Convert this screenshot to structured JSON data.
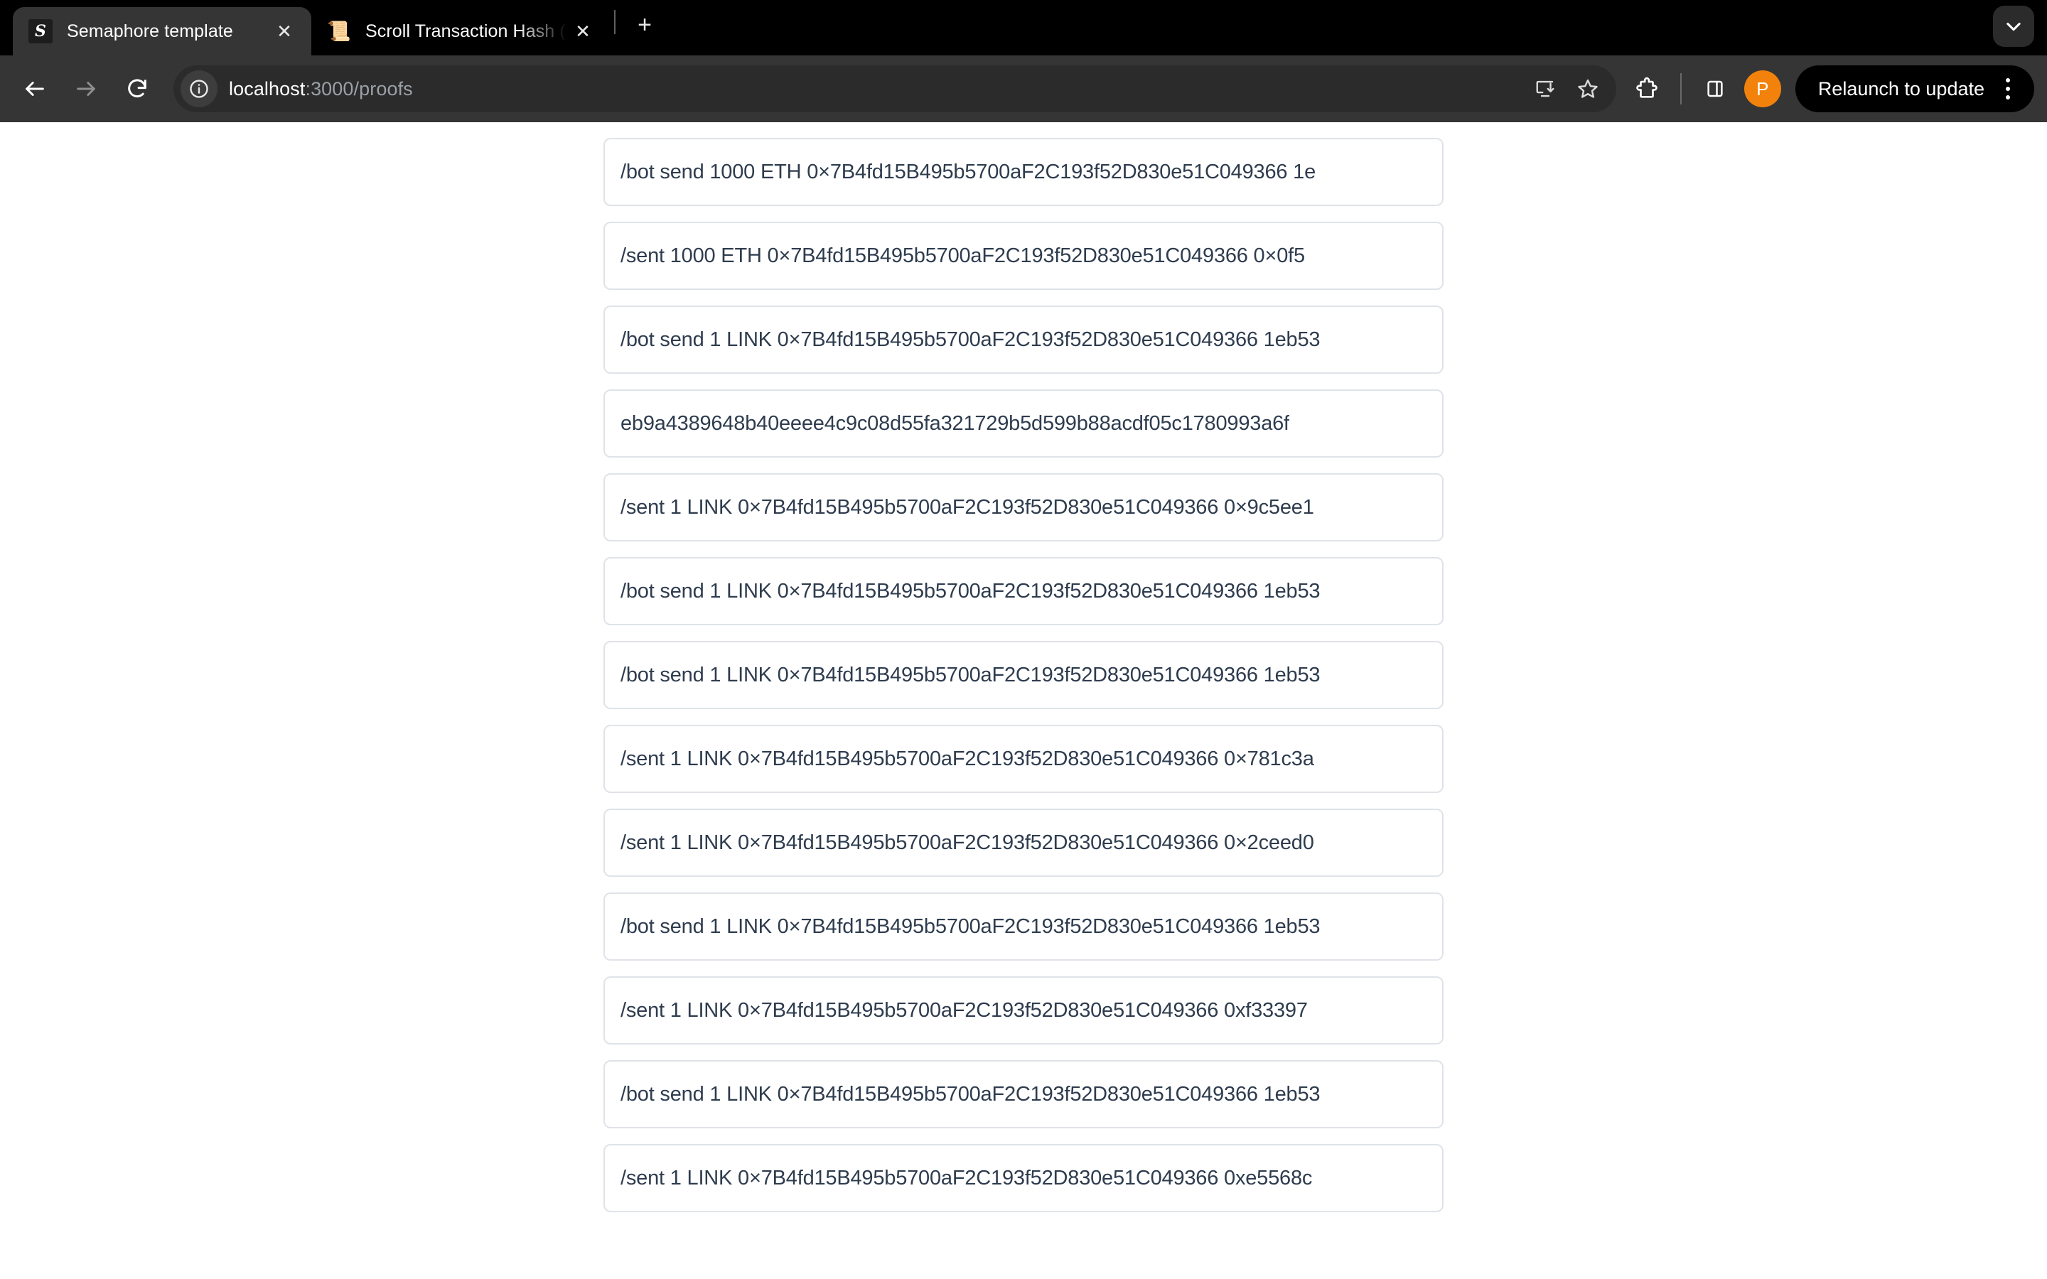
{
  "window": {
    "tabs": [
      {
        "title": "Semaphore template",
        "favicon_name": "semaphore-favicon",
        "favicon_glyph": "S",
        "active": true,
        "close_glyph": "✕"
      },
      {
        "title": "Scroll Transaction Hash (Txha",
        "favicon_name": "scroll-favicon",
        "favicon_glyph": "📜",
        "active": false,
        "close_glyph": "✕"
      }
    ],
    "new_tab_glyph": "+",
    "tab_search_icon": "chevron-down-icon"
  },
  "toolbar": {
    "back_icon": "back-arrow-icon",
    "forward_icon": "forward-arrow-icon",
    "reload_icon": "reload-icon",
    "site_info_icon": "info-circle-icon",
    "url_host": "localhost",
    "url_rest": ":3000/proofs",
    "url_full": "localhost:3000/proofs",
    "install_icon": "install-app-icon",
    "bookmark_icon": "star-icon",
    "extensions_icon": "puzzle-piece-icon",
    "side_panel_icon": "side-panel-icon",
    "profile_initial": "P",
    "relaunch_label": "Relaunch to update",
    "menu_icon": "three-dot-menu-icon"
  },
  "page": {
    "proofs": [
      {
        "text": "/bot send 1000 ETH 0×7B4fd15B495b5700aF2C193f52D830e51C049366 1e"
      },
      {
        "text": "/sent 1000 ETH 0×7B4fd15B495b5700aF2C193f52D830e51C049366 0×0f5"
      },
      {
        "text": "/bot send 1 LINK 0×7B4fd15B495b5700aF2C193f52D830e51C049366 1eb53"
      },
      {
        "text": "eb9a4389648b40eeee4c9c08d55fa321729b5d599b88acdf05c1780993a6f"
      },
      {
        "text": "/sent 1 LINK 0×7B4fd15B495b5700aF2C193f52D830e51C049366 0×9c5ee1"
      },
      {
        "text": "/bot send 1 LINK 0×7B4fd15B495b5700aF2C193f52D830e51C049366 1eb53"
      },
      {
        "text": "/bot send 1 LINK 0×7B4fd15B495b5700aF2C193f52D830e51C049366 1eb53"
      },
      {
        "text": "/sent 1 LINK 0×7B4fd15B495b5700aF2C193f52D830e51C049366 0×781c3a"
      },
      {
        "text": "/sent 1 LINK 0×7B4fd15B495b5700aF2C193f52D830e51C049366 0×2ceed0"
      },
      {
        "text": "/bot send 1 LINK 0×7B4fd15B495b5700aF2C193f52D830e51C049366 1eb53"
      },
      {
        "text": "/sent 1 LINK 0×7B4fd15B495b5700aF2C193f52D830e51C049366 0xf33397"
      },
      {
        "text": "/bot send 1 LINK 0×7B4fd15B495b5700aF2C193f52D830e51C049366 1eb53"
      },
      {
        "text": "/sent 1 LINK 0×7B4fd15B495b5700aF2C193f52D830e51C049366 0xe5568c"
      }
    ]
  },
  "colors": {
    "tabstrip_bg": "#000000",
    "toolbar_bg": "#353535",
    "omnibox_bg": "#2b2b2b",
    "accent_avatar": "#f2820c",
    "row_border": "#dfe3e8",
    "row_text": "#2e3c4e",
    "page_bg": "#ffffff"
  }
}
